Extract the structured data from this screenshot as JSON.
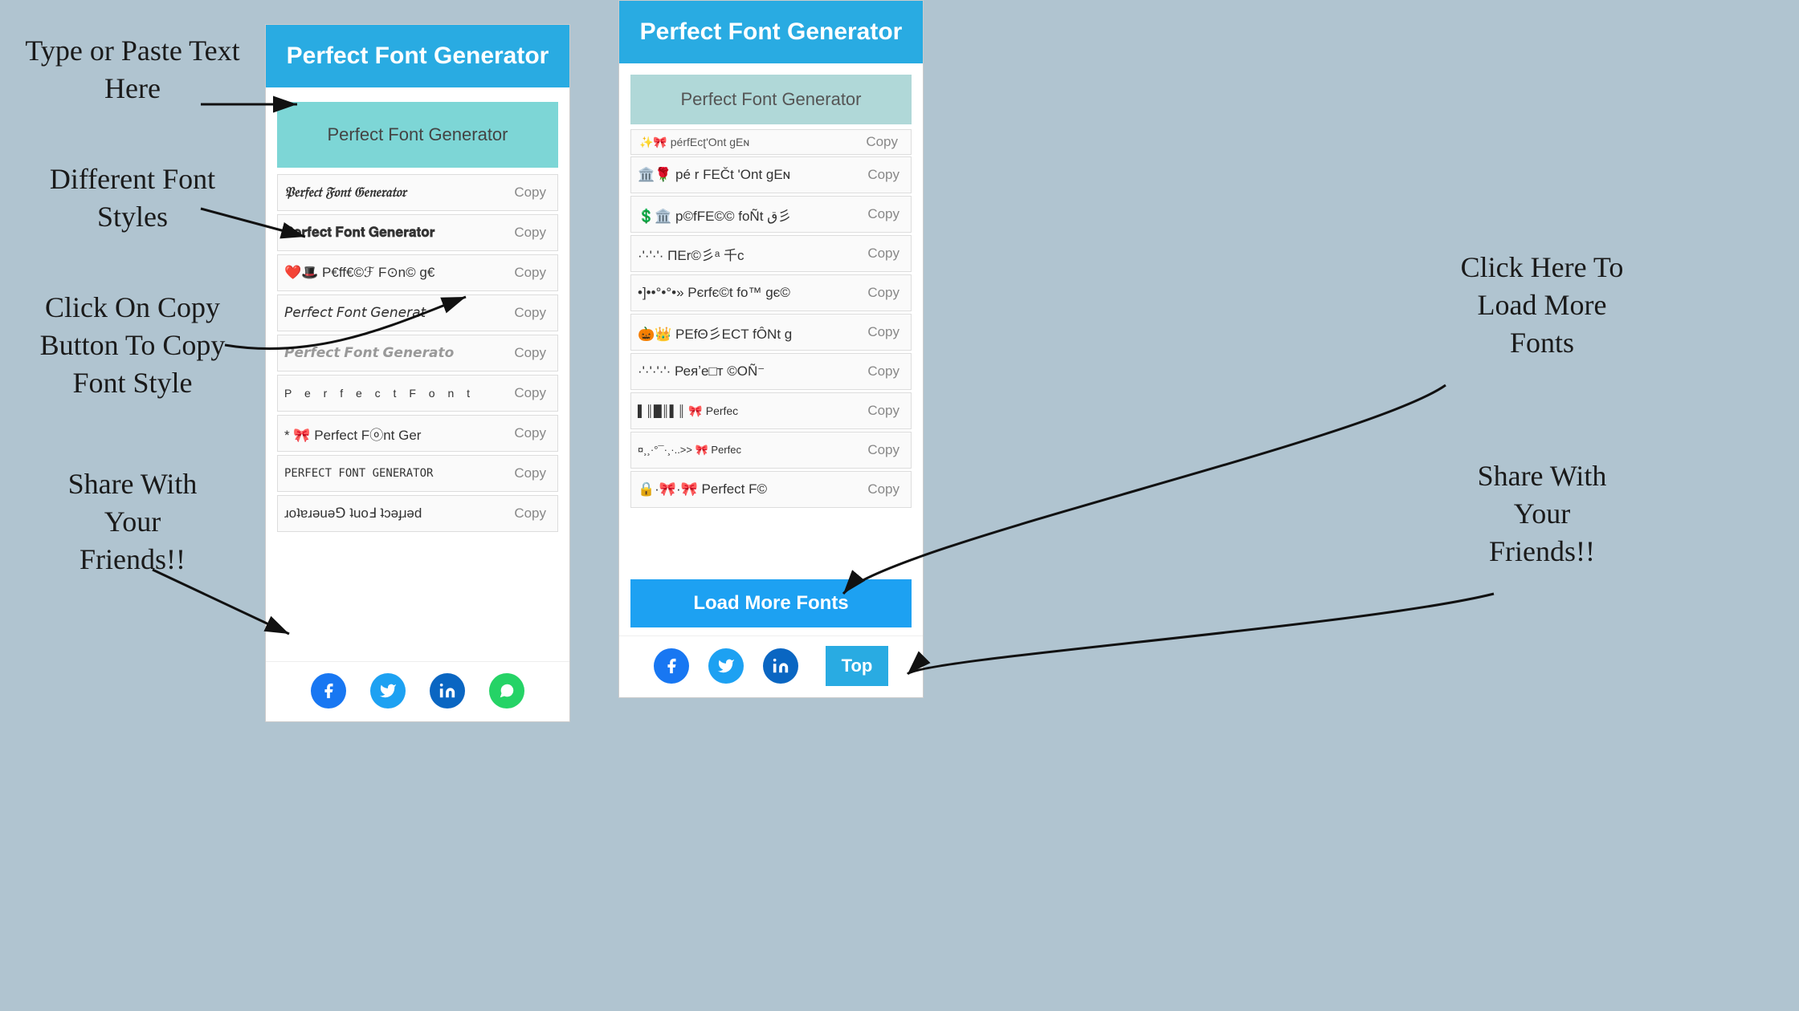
{
  "app": {
    "title": "Perfect Font Generator",
    "background": "#b0c4d0"
  },
  "annotations": {
    "type_paste": "Type or Paste Text Here",
    "diff_styles": "Different Font Styles",
    "click_copy": "Click On Copy\nButton To Copy\nFont Style",
    "share": "Share With\nYour\nFriends!!",
    "load_more_ann": "Click Here To\nLoad More\nFonts",
    "share2": "Share With\nYour\nFriends!!"
  },
  "panel_left": {
    "header": "Perfect Font Generator",
    "input_placeholder": "Perfect Font Generator",
    "input_value": "Perfect Font Generator",
    "fonts": [
      {
        "text": "𝔓𝔢𝔯𝔣𝔢𝔠𝔱 𝔉𝔬𝔫𝔱 𝔊𝔢𝔫𝔢𝔯𝔞𝔱𝔬𝔯",
        "style": "gothic",
        "copy": "Copy"
      },
      {
        "text": "𝐏𝐞𝐫𝐟𝐞𝐜𝐭 𝐅𝐨𝐧𝐭 𝐆𝐞𝐧𝐞𝐫𝐚𝐭𝐨𝐫",
        "style": "bold",
        "copy": "Copy"
      },
      {
        "text": "❤️🎩 P€ff€©ℱ F⊙n© g€",
        "style": "emoji",
        "copy": "Copy"
      },
      {
        "text": "𝘗𝘦𝘳𝘧𝘦𝘤𝘵 𝘍𝘰𝘯𝘵 𝘎𝘦𝘯𝘦𝘳𝘢𝘵",
        "style": "italic",
        "copy": "Copy"
      },
      {
        "text": "𝙋𝙚𝙧𝙛𝙚𝙘𝙩 𝙁𝙤𝙣𝙩 𝙂𝙚𝙣𝙚𝙧𝙖𝙩𝙤",
        "style": "bold-italic",
        "copy": "Copy"
      },
      {
        "text": "P e r f e c t  F o n t",
        "style": "spaced",
        "copy": "Copy"
      },
      {
        "text": "* 🎀 Perfect Fⓞnt Ger",
        "style": "deco",
        "copy": "Copy"
      },
      {
        "text": "PERFECT FONT GENERATOR",
        "style": "uppercase",
        "copy": "Copy"
      },
      {
        "text": "ɹoʇɐɹǝuǝ⅁ ʇuoℲ ʇɔǝɟɹǝd",
        "style": "reversed",
        "copy": "Copy"
      }
    ],
    "share_icons": [
      "facebook",
      "twitter",
      "linkedin",
      "whatsapp"
    ]
  },
  "panel_right": {
    "header": "Perfect Font Generator",
    "input_value": "Perfect Font Generator",
    "partial_top": "p€ɾfɛcʈ'Ont gEɴ",
    "fonts": [
      {
        "text": "🏛️🌹 pé r FEČt 'Ont gEɴ",
        "copy": "Copy"
      },
      {
        "text": "💲🏛️ p©fFE©© foÑt ق彡",
        "copy": "Copy"
      },
      {
        "text": "·'·'·'· ΠEr©彡ᵃ 千c",
        "copy": "Copy"
      },
      {
        "text": "•]••°•°•» Рєrfє©t fo™ gє©",
        "copy": "Copy"
      },
      {
        "text": "🎃👑 ΡΕfΘ彡ΕCΤ fÔΝt g",
        "copy": "Copy"
      },
      {
        "text": "·'·'·'·'· Реяʼе□т ©ОÑ⁻",
        "copy": "Copy"
      },
      {
        "text": "▌║█║▌║ 🎀 Рerfec",
        "copy": "Copy"
      },
      {
        "text": "¤¸¸·°¯·¸¸·..>>  🎀  Рerfec",
        "copy": "Copy"
      },
      {
        "text": "🔒·🎀·🎀 Perfect F©",
        "copy": "Copy"
      }
    ],
    "load_more": "Load More Fonts",
    "top_btn": "Top",
    "share_icons": [
      "facebook",
      "twitter",
      "linkedin"
    ]
  },
  "copy_label": "Copy",
  "load_more_label": "Load More Fonts",
  "top_label": "Top"
}
